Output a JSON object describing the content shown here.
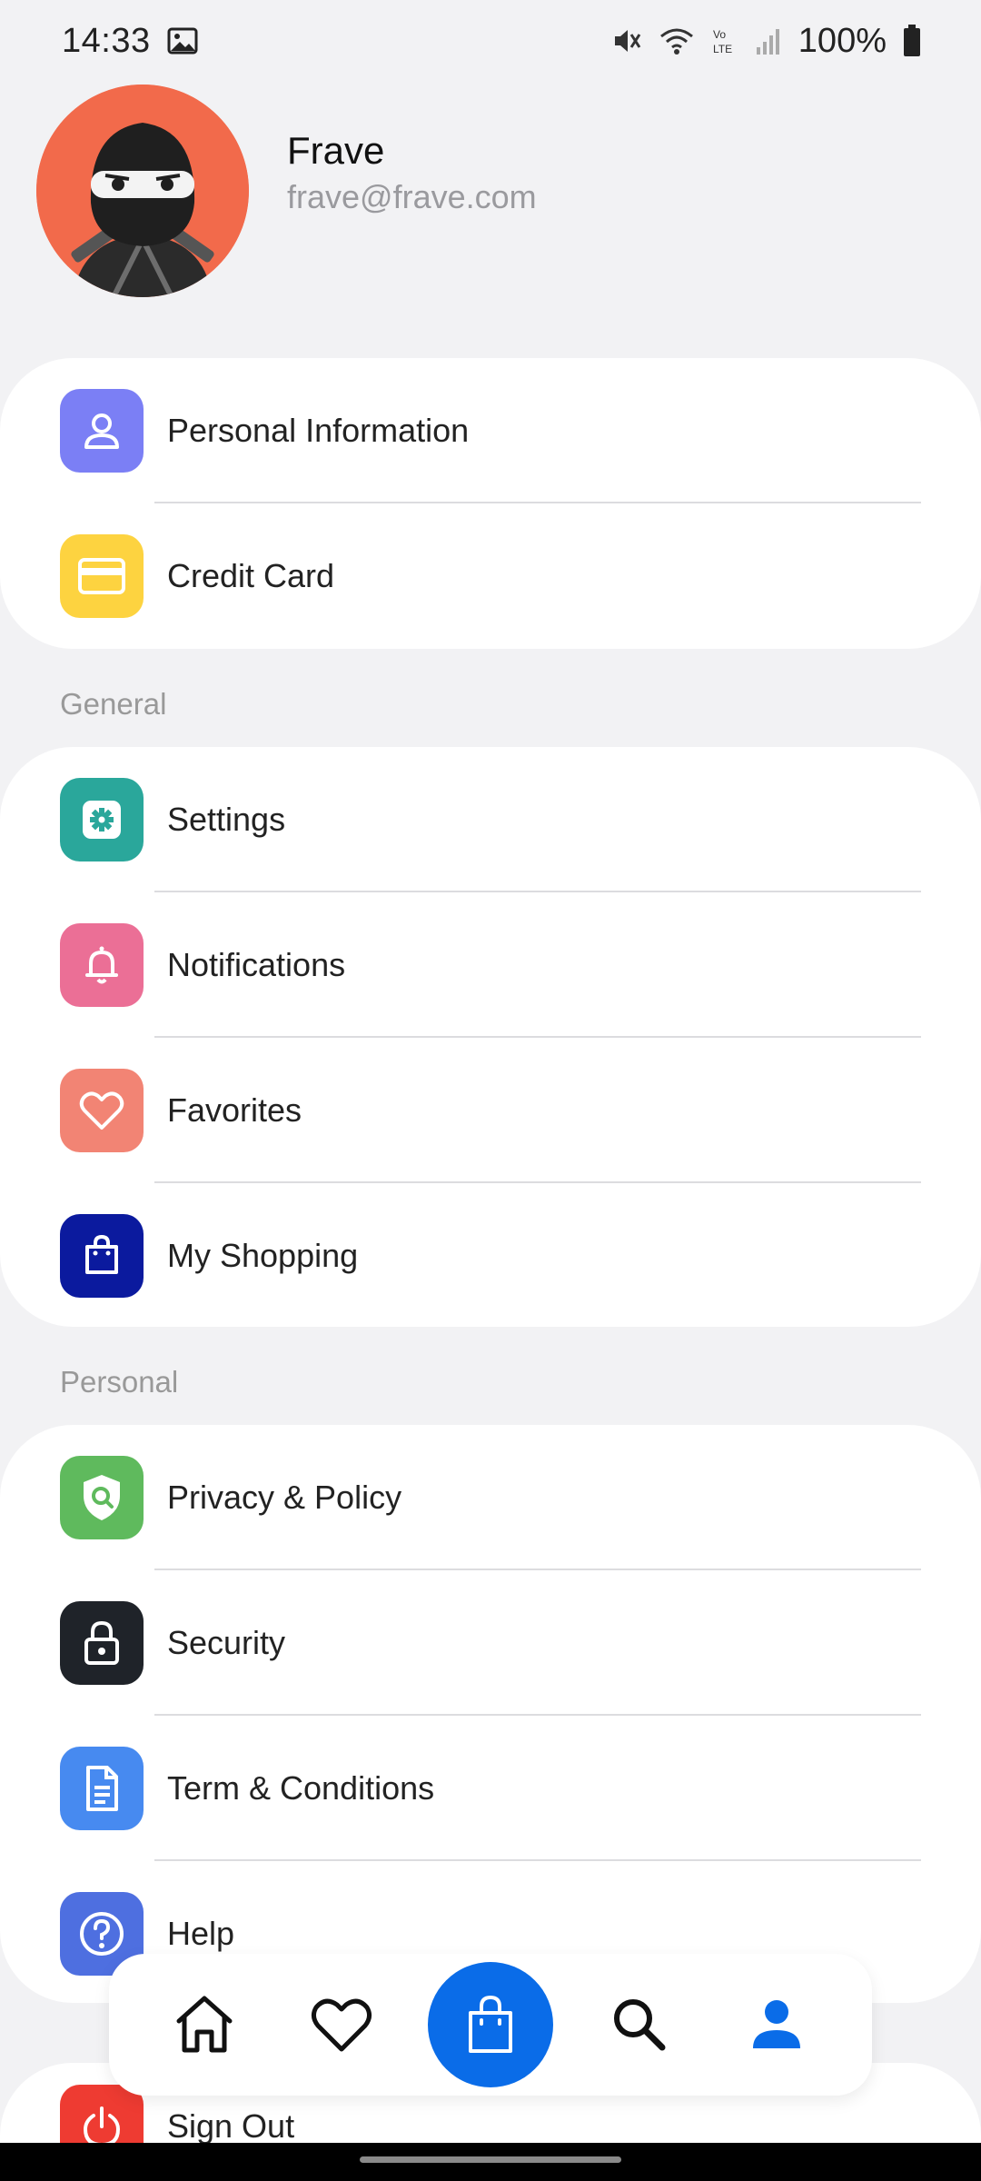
{
  "status_bar": {
    "time": "14:33",
    "battery": "100%"
  },
  "profile": {
    "name": "Frave",
    "email": "frave@frave.com"
  },
  "account_items": [
    {
      "label": "Personal Information",
      "icon": "person-icon",
      "color": "#7b7ff5"
    },
    {
      "label": "Credit Card",
      "icon": "credit-card-icon",
      "color": "#fdd340"
    }
  ],
  "sections": {
    "general_title": "General",
    "personal_title": "Personal"
  },
  "general_items": [
    {
      "label": "Settings",
      "icon": "gear-icon",
      "color": "#2aa79b"
    },
    {
      "label": "Notifications",
      "icon": "bell-icon",
      "color": "#eb6f96"
    },
    {
      "label": "Favorites",
      "icon": "heart-icon",
      "color": "#f28474"
    },
    {
      "label": "My Shopping",
      "icon": "shopping-bag-icon",
      "color": "#0b1a9e"
    }
  ],
  "personal_items": [
    {
      "label": "Privacy & Policy",
      "icon": "shield-search-icon",
      "color": "#5fba5d"
    },
    {
      "label": "Security",
      "icon": "lock-icon",
      "color": "#1f2329"
    },
    {
      "label": "Term & Conditions",
      "icon": "document-icon",
      "color": "#478af0"
    },
    {
      "label": "Help",
      "icon": "help-icon",
      "color": "#4e6fe0"
    }
  ],
  "footer_items": [
    {
      "label": "Sign Out",
      "icon": "power-icon",
      "color": "#ee3b32"
    }
  ],
  "bottom_nav": {
    "accent": "#0a6ce8",
    "items": [
      "home-icon",
      "heart-icon",
      "shopping-bag-icon",
      "search-icon",
      "profile-icon"
    ]
  }
}
